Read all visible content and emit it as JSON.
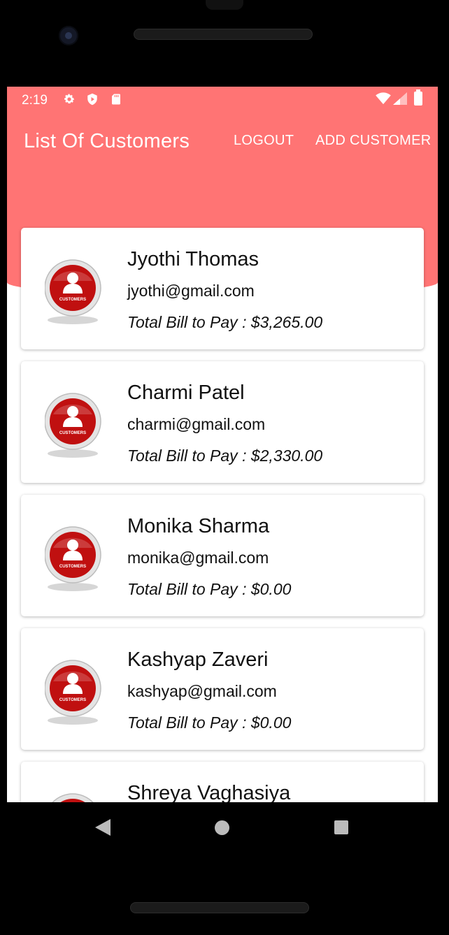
{
  "status": {
    "time": "2:19",
    "icons": [
      "settings-icon",
      "shield-play-icon",
      "sd-card-icon",
      "wifi-icon",
      "signal-icon",
      "battery-icon"
    ]
  },
  "toolbar": {
    "title": "List Of Customers",
    "logout_label": "LOGOUT",
    "add_customer_label": "ADD CUSTOMER"
  },
  "colors": {
    "header": "#ff7474",
    "avatar_red": "#c01010"
  },
  "avatar": {
    "label": "CUSTOMERS"
  },
  "customers": [
    {
      "name": "Jyothi Thomas",
      "email": "jyothi@gmail.com",
      "bill": "Total Bill to Pay : $3,265.00"
    },
    {
      "name": "Charmi Patel",
      "email": "charmi@gmail.com",
      "bill": "Total Bill to Pay : $2,330.00"
    },
    {
      "name": "Monika Sharma",
      "email": "monika@gmail.com",
      "bill": "Total Bill to Pay : $0.00"
    },
    {
      "name": "Kashyap Zaveri",
      "email": "kashyap@gmail.com",
      "bill": "Total Bill to Pay : $0.00"
    },
    {
      "name": "Shreya Vaghasiya",
      "email": "",
      "bill": ""
    }
  ]
}
